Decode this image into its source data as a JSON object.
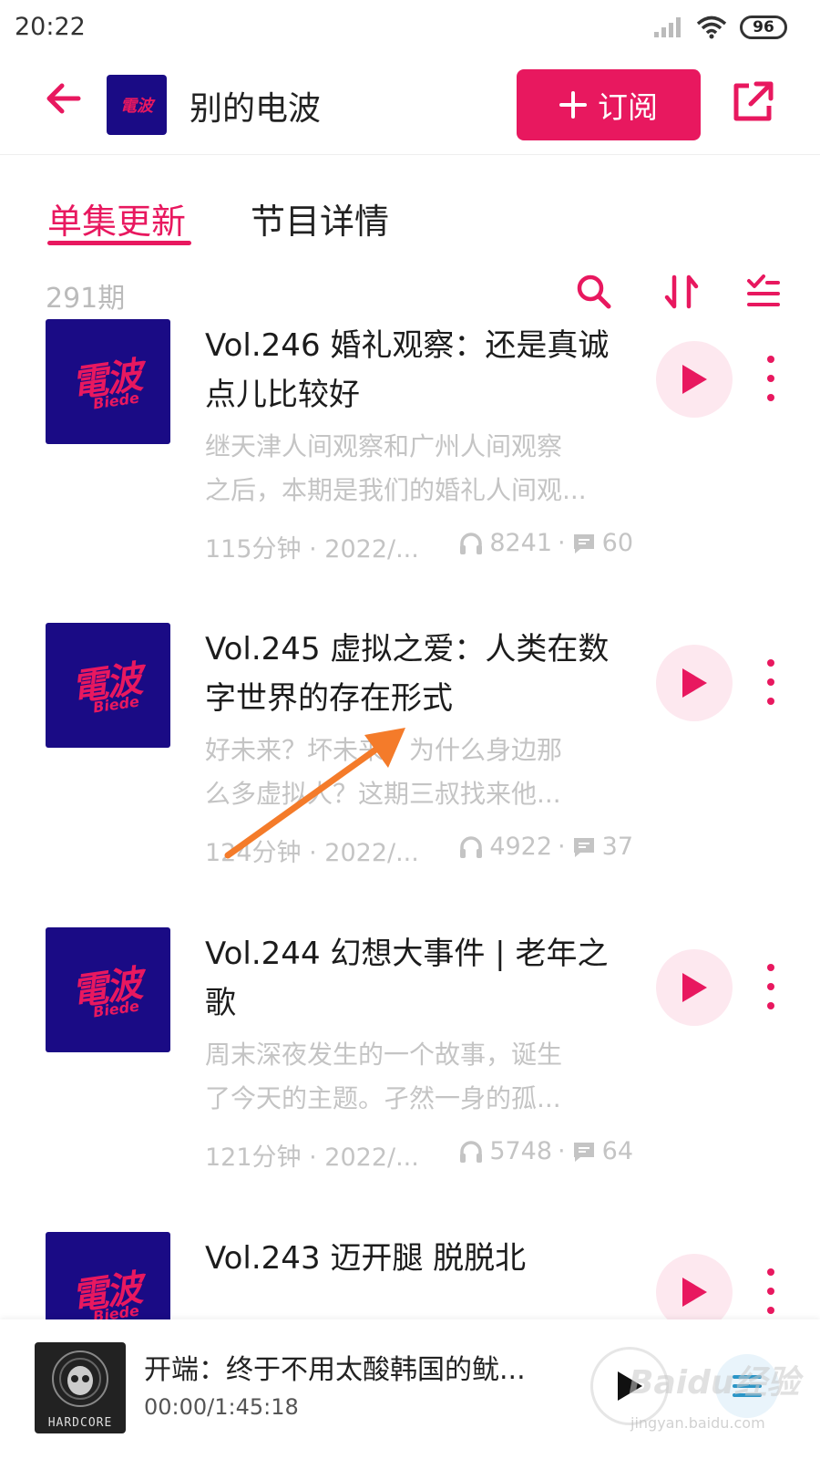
{
  "status_bar": {
    "time": "20:22",
    "battery": "96"
  },
  "header": {
    "title": "别的电波",
    "subscribe_label": "订阅",
    "cover_text": "電波"
  },
  "tabs": [
    {
      "label": "单集更新"
    },
    {
      "label": "节目详情"
    }
  ],
  "toolbar": {
    "episode_count": "291期"
  },
  "episodes": [
    {
      "title": "Vol.246 婚礼观察：还是真诚点儿比较好",
      "desc_line1": "继天津人间观察和广州人间观察",
      "desc_line2": "之后，本期是我们的婚礼人间观...",
      "meta": "115分钟 · 2022/...",
      "plays": "8241",
      "comments": "60",
      "cover_main": "電波",
      "cover_sub": "Biede"
    },
    {
      "title": "Vol.245 虚拟之爱：人类在数字世界的存在形式",
      "desc_line1": "好未来？坏未来？为什么身边那",
      "desc_line2": "么多虚拟人？这期三叔找来他...",
      "meta": "124分钟 · 2022/...",
      "plays": "4922",
      "comments": "37",
      "cover_main": "電波",
      "cover_sub": "Biede"
    },
    {
      "title": "Vol.244 幻想大事件 | 老年之歌",
      "desc_line1": "周末深夜发生的一个故事，诞生",
      "desc_line2": "了今天的主题。孑然一身的孤...",
      "meta": "121分钟 · 2022/...",
      "plays": "5748",
      "comments": "64",
      "cover_main": "電波",
      "cover_sub": "Biede"
    },
    {
      "title": "Vol.243 迈开腿 脱脱北",
      "desc_line1": "",
      "desc_line2": "",
      "meta": "",
      "plays": "",
      "comments": "",
      "cover_main": "電波",
      "cover_sub": "Biede"
    }
  ],
  "player": {
    "title": "开端：终于不用太酸韩国的鱿...",
    "time": "00:00/1:45:18",
    "cover_label": "HARDCORE"
  },
  "watermark": {
    "main": "Baidu经验",
    "sub": "jingyan.baidu.com"
  },
  "colors": {
    "accent": "#e8185f",
    "cover_bg": "#1a0b85",
    "play_bg": "#fde8ef",
    "arrow": "#f47b2a"
  },
  "icons": {
    "back": "arrow-left-icon",
    "share": "share-icon",
    "search": "search-icon",
    "sort": "sort-icon",
    "filter": "checklist-icon",
    "headphones": "headphones-icon",
    "comment": "comment-icon",
    "play": "play-icon",
    "more": "more-vertical-icon",
    "playlist": "playlist-icon"
  }
}
